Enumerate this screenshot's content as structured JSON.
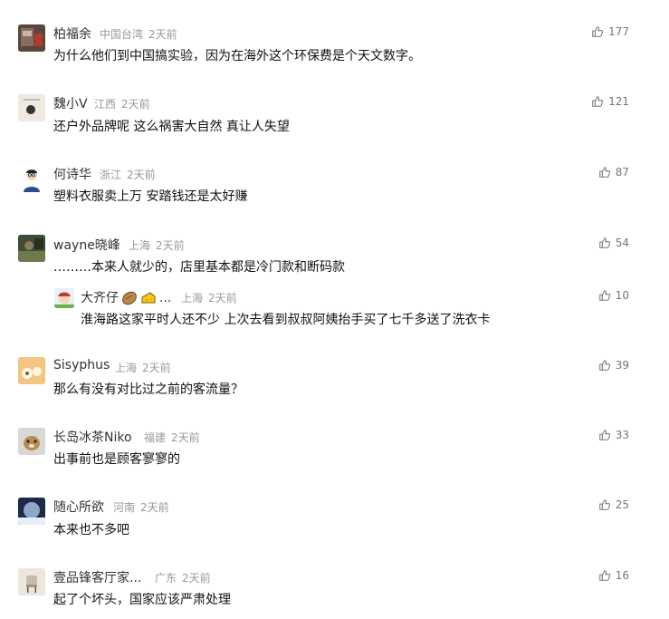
{
  "comments": [
    {
      "name": "柏福余",
      "location": "中国台湾",
      "time": "2天前",
      "text": "为什么他们到中国搞实验，因为在海外这个环保费是个天文数字。",
      "likes": "177"
    },
    {
      "name": "魏小V",
      "location": "江西",
      "time": "2天前",
      "text": "还户外品牌呢 这么祸害大自然 真让人失望",
      "likes": "121"
    },
    {
      "name": "何诗华",
      "location": "浙江",
      "time": "2天前",
      "text": "塑料衣服卖上万 安踏钱还是太好赚",
      "likes": "87"
    },
    {
      "name": "wayne晓峰",
      "location": "上海",
      "time": "2天前",
      "text": "………本来人就少的，店里基本都是冷门款和断码款",
      "likes": "54"
    },
    {
      "name": "大齐仔",
      "name_suffix": "...",
      "location": "上海",
      "time": "2天前",
      "text": "淮海路这家平时人还不少 上次去看到叔叔阿姨抬手买了七千多送了洗衣卡",
      "likes": "10"
    },
    {
      "name": "Sisyphus",
      "location": "上海",
      "time": "2天前",
      "text": "那么有没有对比过之前的客流量？",
      "likes": "39"
    },
    {
      "name": "长岛冰茶Niko",
      "location": "福建",
      "time": "2天前",
      "text": "出事前也是顾客寥寥的",
      "likes": "33"
    },
    {
      "name": "随心所欲",
      "location": "河南",
      "time": "2天前",
      "text": "本来也不多吧",
      "likes": "25"
    },
    {
      "name": "壹品锋客厅家...",
      "location": "广东",
      "time": "2天前",
      "text": "起了个坏头，国家应该严肃处理",
      "likes": "16"
    }
  ],
  "icons": {
    "like": "thumbs-up-icon",
    "emoji1": "peanut-icon",
    "emoji2": "cheese-icon"
  }
}
